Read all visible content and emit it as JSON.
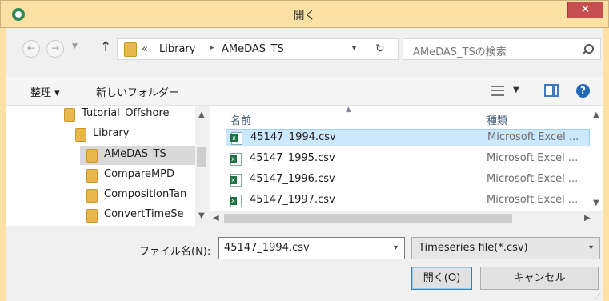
{
  "window": {
    "title": "開く",
    "close_label": "✕"
  },
  "nav": {
    "back_glyph": "←",
    "forward_glyph": "→",
    "up_glyph": "↑",
    "address": {
      "overflow": "«",
      "crumbs": [
        "Library",
        "AMeDAS_TS"
      ],
      "separator": "▸"
    },
    "search_placeholder": "AMeDAS_TSの検索"
  },
  "toolbar": {
    "organize_label": "整理 ▾",
    "new_folder_label": "新しいフォルダー"
  },
  "tree": {
    "items": [
      {
        "label": "Tutorial_Offshore",
        "selected": false
      },
      {
        "label": "Library",
        "selected": false
      },
      {
        "label": "AMeDAS_TS",
        "selected": true
      },
      {
        "label": "CompareMPD",
        "selected": false
      },
      {
        "label": "CompositionTan",
        "selected": false
      },
      {
        "label": "ConvertTimeSe",
        "selected": false
      }
    ]
  },
  "files": {
    "columns": [
      "名前",
      "種類"
    ],
    "rows": [
      {
        "name": "45147_1994.csv",
        "type": "Microsoft Excel ...",
        "selected": true
      },
      {
        "name": "45147_1995.csv",
        "type": "Microsoft Excel ...",
        "selected": false
      },
      {
        "name": "45147_1996.csv",
        "type": "Microsoft Excel ...",
        "selected": false
      },
      {
        "name": "45147_1997.csv",
        "type": "Microsoft Excel ...",
        "selected": false
      }
    ]
  },
  "bottom": {
    "filename_label": "ファイル名(N):",
    "filename_value": "45147_1994.csv",
    "filter_value": "Timeseries file(*.csv)",
    "open_label": "開く(O)",
    "cancel_label": "キャンセル"
  },
  "colors": {
    "frame": "#fde0a4",
    "close": "#c74f4f",
    "selection": "#cce8ff"
  },
  "icons": [
    "app-icon",
    "folder-icon",
    "refresh-icon",
    "search-icon",
    "view-icon",
    "preview-pane-icon",
    "help-icon",
    "excel-file-icon"
  ]
}
